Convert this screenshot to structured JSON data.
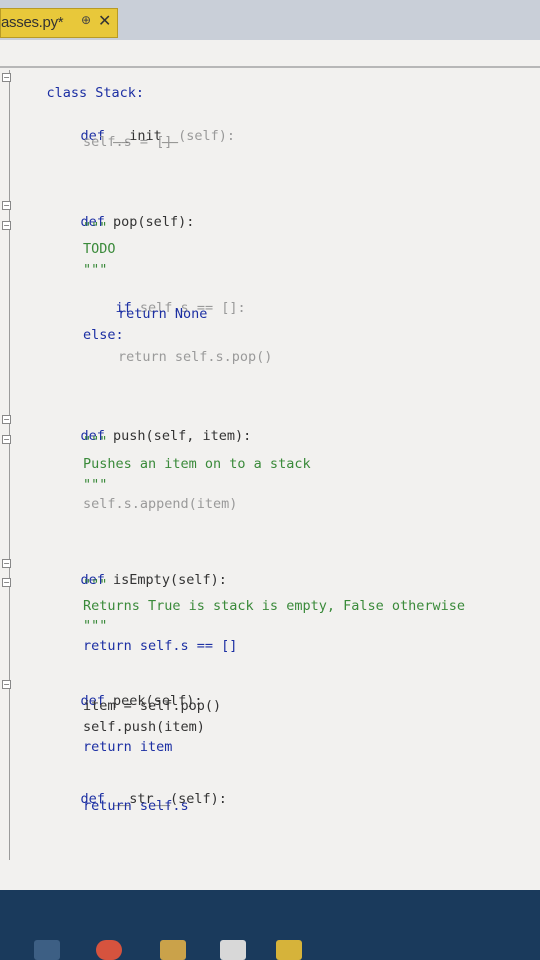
{
  "tab": {
    "filename": "asses.py*",
    "pin_glyph": "⊕",
    "close_glyph": "✕"
  },
  "code": {
    "line1": "class Stack:",
    "line2_kw": "def",
    "line2_name": "__init__",
    "line2_args": "(self):",
    "line3": "self.s = []",
    "pop_def": "def",
    "pop_name": "pop(self):",
    "pop_doc_open": "\"\"\"",
    "pop_doc_text": "TODO",
    "pop_doc_close": "\"\"\"",
    "pop_if": "if",
    "pop_if_rest": "self.s == []:",
    "pop_return_none": "return None",
    "pop_else": "else:",
    "pop_return_pop": "return self.s.pop()",
    "push_def": "def",
    "push_sig": "push(self, item):",
    "push_doc_open": "\"\"\"",
    "push_doc_text": "Pushes an item on to a stack",
    "push_doc_close": "\"\"\"",
    "push_body": "self.s.append(item)",
    "empty_def": "def",
    "empty_sig": "isEmpty(self):",
    "empty_doc_open": "\"\"\"",
    "empty_doc_text": "Returns True is stack is empty, False otherwise",
    "empty_doc_close": "\"\"\"",
    "empty_return": "return self.s == []",
    "peek_def": "def",
    "peek_sig": "peek(self):",
    "peek_l1": "item = self.pop()",
    "peek_l2": "self.push(item)",
    "peek_l3": "return item",
    "str_def": "def",
    "str_sig": "__str__(self):",
    "str_return": "return self.s"
  },
  "colors": {
    "keyword": "#1c2fa3",
    "self": "#9a9a9a",
    "docstring": "#3a8a3a",
    "tab_active": "#e8c83a",
    "taskbar": "#1a3a5c"
  },
  "taskbar": {
    "icons": [
      "task-view-icon",
      "chrome-icon",
      "file-explorer-icon",
      "app-icon",
      "app-icon-2"
    ]
  }
}
